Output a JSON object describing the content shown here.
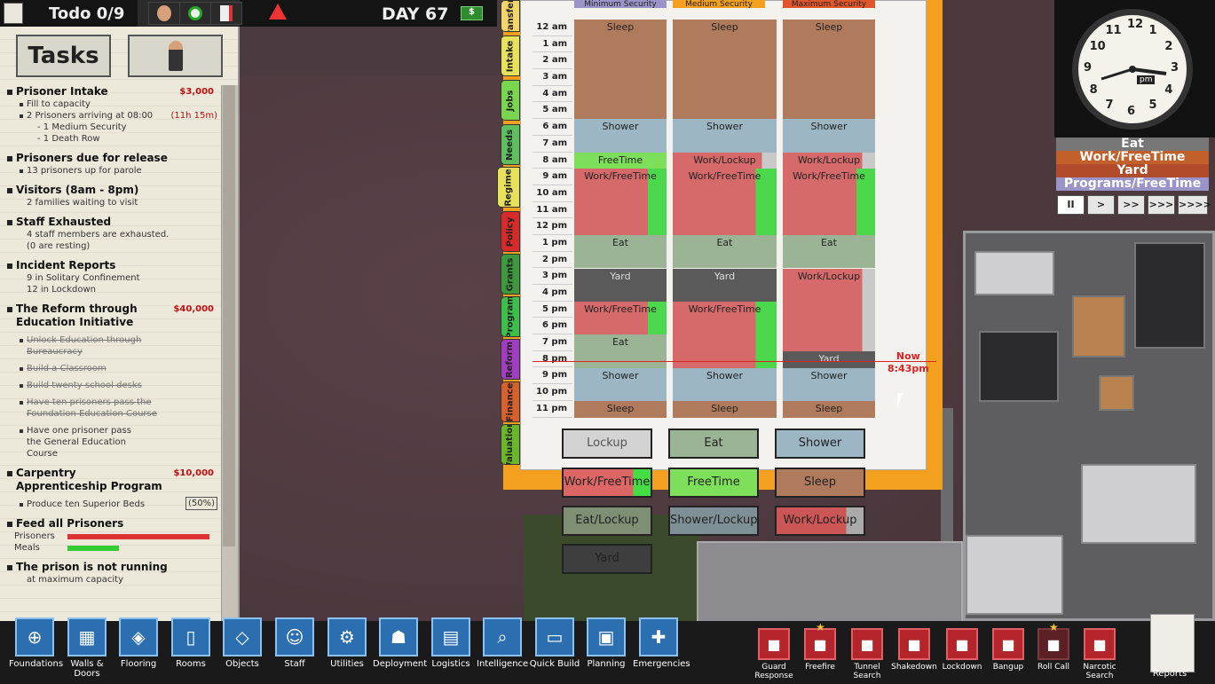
{
  "topbar": {
    "todo_title": "Todo 0/9",
    "day": "DAY 67",
    "cash_icon": "$"
  },
  "panel": {
    "tasks_tab": "Tasks",
    "tasks": [
      {
        "title": "Prisoner Intake",
        "reward": "$3,000",
        "subs": [
          "Fill to capacity",
          "2 Prisoners arriving at 08:00",
          "- 1 Medium Security",
          "- 1 Death Row"
        ],
        "timer": "(11h  15m)"
      },
      {
        "title": "Prisoners due for release",
        "subs": [
          "13 prisoners up for parole"
        ]
      },
      {
        "title": "Visitors (8am - 8pm)",
        "subs": [
          "2 families waiting to visit"
        ]
      },
      {
        "title": "Staff Exhausted",
        "subs": [
          "4 staff members are exhausted.",
          "(0 are resting)"
        ]
      },
      {
        "title": "Incident Reports",
        "subs": [
          "9 in Solitary Confinement",
          "12 in Lockdown"
        ]
      },
      {
        "title": "The Reform through Education Initiative",
        "reward": "$40,000",
        "subs": [
          "Unlock Education through Bureaucracy",
          "Build a Classroom",
          "Build twenty school desks",
          "Have ten prisoners pass the Foundation Education Course",
          "Have one prisoner pass the General Education Course"
        ]
      },
      {
        "title": "Carpentry Apprenticeship Program",
        "reward": "$10,000",
        "subs": [
          "Produce ten Superior Beds"
        ],
        "pct": "(50%)"
      },
      {
        "title": "Feed all Prisoners",
        "subs": [
          "Prisoners",
          "Meals"
        ],
        "prisoners_fed": 1.0,
        "meals_fed": 0.36
      },
      {
        "title": "The prison is not running",
        "subs": [
          "at maximum capacity"
        ]
      }
    ]
  },
  "sidetabs": [
    "Transfers",
    "Intake",
    "Jobs",
    "Needs",
    "Regime",
    "Policy",
    "Grants",
    "Program",
    "Reform",
    "Finance",
    "Valuation"
  ],
  "regime": {
    "columns": [
      "Minimum Security",
      "Medium Security",
      "Maximum Security"
    ],
    "column_colors": [
      "#9a94c8",
      "#f3a01f",
      "#e0562a"
    ],
    "hours": [
      "12 am",
      "1 am",
      "2 am",
      "3 am",
      "4 am",
      "5 am",
      "6 am",
      "7 am",
      "8 am",
      "9 am",
      "10 am",
      "11 am",
      "12 pm",
      "1 pm",
      "2 pm",
      "3 pm",
      "4 pm",
      "5 pm",
      "6 pm",
      "7 pm",
      "8 pm",
      "9 pm",
      "10 pm",
      "11 pm"
    ],
    "now_label": "Now",
    "now_time": "8:43pm",
    "minimum": [
      "Sleep",
      "",
      "",
      "",
      "",
      "",
      "Shower",
      "",
      "FreeTime",
      "Work/FreeTime",
      "",
      "",
      "",
      "Eat",
      "",
      "Yard",
      "",
      "Work/FreeTime",
      "",
      "Eat",
      "",
      "Shower",
      "",
      "Sleep"
    ],
    "medium": [
      "Sleep",
      "",
      "",
      "",
      "",
      "",
      "Shower",
      "",
      "Work/Lockup",
      "Work/FreeTime",
      "",
      "",
      "",
      "Eat",
      "",
      "Yard",
      "",
      "Work/FreeTime",
      "",
      "",
      "",
      "Shower",
      "",
      "Sleep"
    ],
    "maximum": [
      "Sleep",
      "",
      "",
      "",
      "",
      "",
      "Shower",
      "",
      "Work/Lockup",
      "Work/FreeTime",
      "",
      "",
      "",
      "Eat",
      "",
      "Work/Lockup",
      "",
      "",
      "",
      "",
      "Yard",
      "Shower",
      "",
      "Sleep"
    ]
  },
  "palette": [
    "Lockup",
    "Eat",
    "Shower",
    "Work/FreeTime",
    "FreeTime",
    "Sleep",
    "Eat/Lockup",
    "Shower/Lockup",
    "Work/Lockup",
    "Yard"
  ],
  "clock": {
    "pm": "pm",
    "nums": [
      "12",
      "1",
      "2",
      "3",
      "4",
      "5",
      "6",
      "7",
      "8",
      "9",
      "10",
      "11"
    ]
  },
  "legend": [
    "Eat",
    "Work/FreeTime",
    "Yard",
    "Programs/FreeTime"
  ],
  "speeds": [
    "II",
    ">",
    ">>",
    ">>>",
    ">>>>"
  ],
  "toolbar": [
    "Foundations",
    "Walls & Doors",
    "Flooring",
    "Rooms",
    "Objects",
    "Staff",
    "Utilities",
    "Deployment",
    "Logistics",
    "Intelligence",
    "Quick Build",
    "Planning",
    "Emergencies"
  ],
  "actions": [
    "Guard Response",
    "Freefire",
    "Tunnel Search",
    "Shakedown",
    "Lockdown",
    "Bangup",
    "Roll Call",
    "Narcotic Search"
  ],
  "reports": "Reports"
}
